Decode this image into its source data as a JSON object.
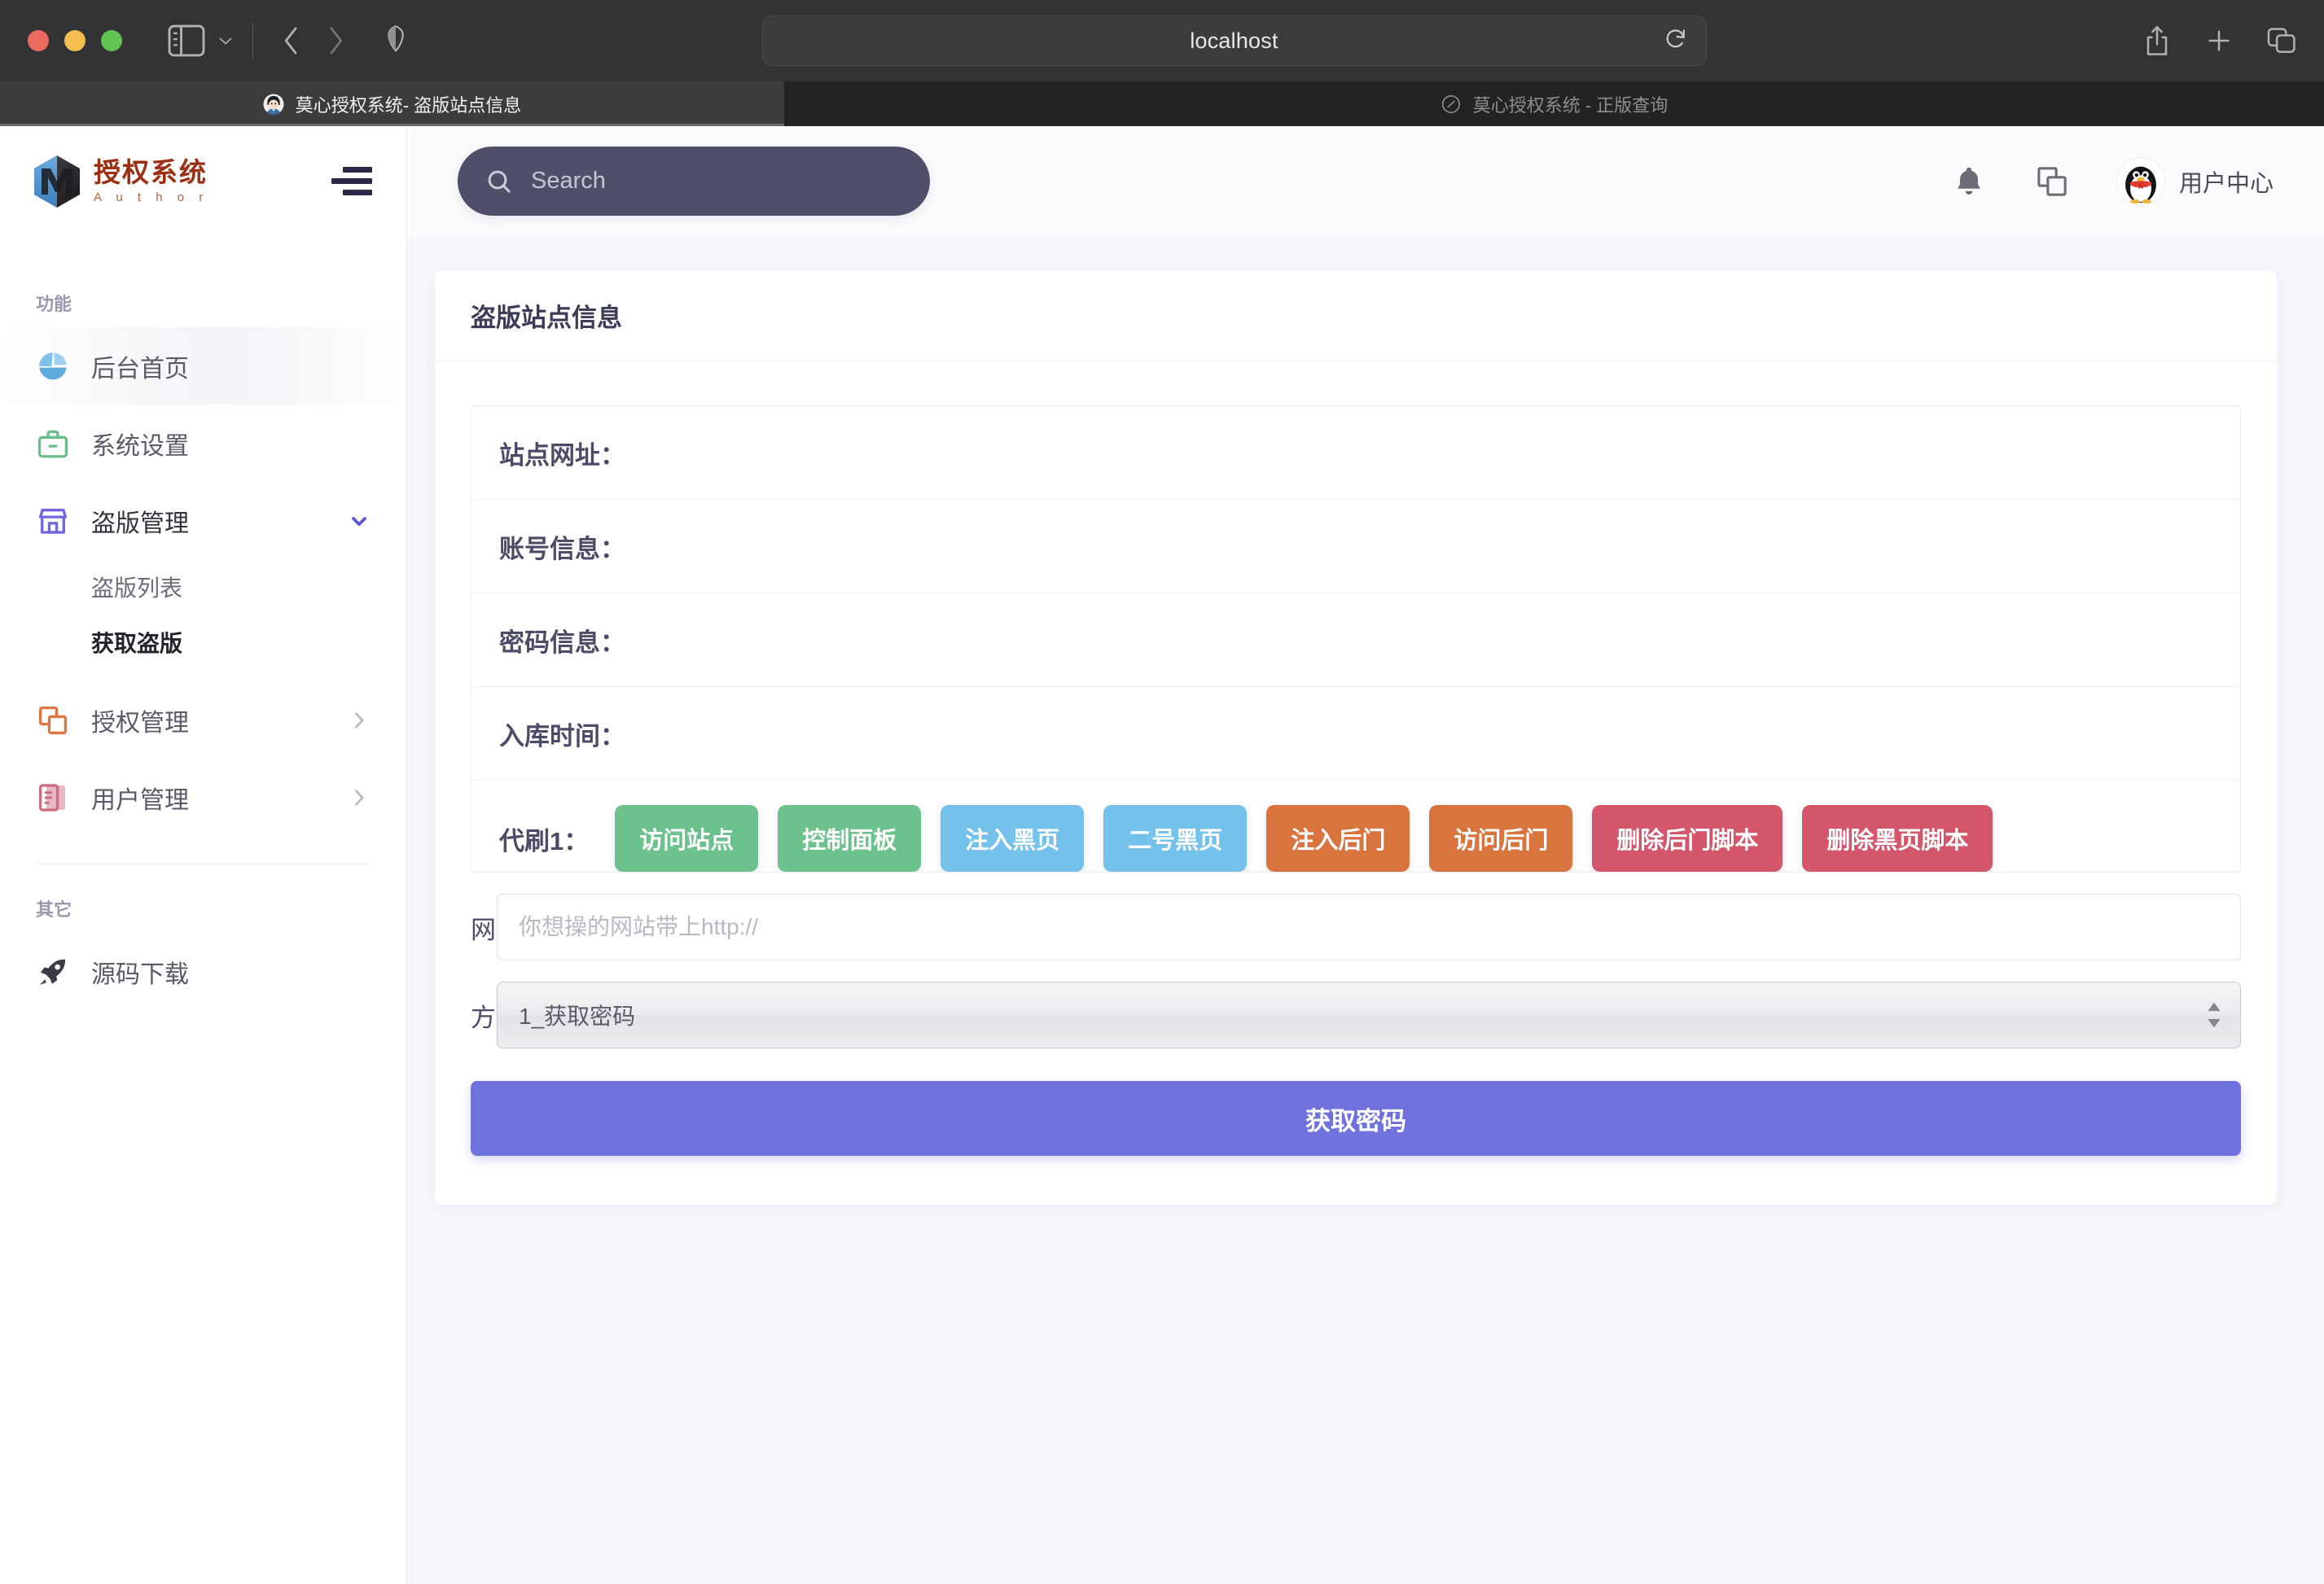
{
  "browser": {
    "url": "localhost",
    "traffic_lights": [
      "close",
      "minimize",
      "zoom"
    ],
    "tabs": [
      {
        "title": "莫心授权系统- 盗版站点信息",
        "active": true
      },
      {
        "title": "莫心授权系统 - 正版查询",
        "active": false
      }
    ],
    "toolbar_icons": [
      "sidebar-icon",
      "chevron-down-icon",
      "back-icon",
      "forward-icon",
      "shield-icon",
      "reload-icon",
      "share-icon",
      "new-tab-icon",
      "tab-overview-icon"
    ]
  },
  "sidebar": {
    "brand": {
      "title": "授权系统",
      "subtitle": "A u t h o r"
    },
    "menu_icon": "hamburger-icon",
    "groups": [
      {
        "label": "功能",
        "items": [
          {
            "label": "后台首页",
            "icon": "pie-chart-icon",
            "caret": null,
            "highlight": true
          },
          {
            "label": "系统设置",
            "icon": "toolbox-icon",
            "caret": null,
            "highlight": false
          },
          {
            "label": "盗版管理",
            "icon": "store-icon",
            "caret": "chevron-down-icon",
            "highlight": false,
            "children": [
              {
                "label": "盗版列表",
                "active": false
              },
              {
                "label": "获取盗版",
                "active": true
              }
            ]
          },
          {
            "label": "授权管理",
            "icon": "copy-icon",
            "caret": "chevron-right-icon",
            "highlight": false
          },
          {
            "label": "用户管理",
            "icon": "doc-icon",
            "caret": "chevron-right-icon",
            "highlight": false
          }
        ]
      },
      {
        "label": "其它",
        "items": [
          {
            "label": "源码下载",
            "icon": "rocket-icon",
            "caret": null,
            "highlight": false
          }
        ]
      }
    ]
  },
  "topbar": {
    "search": {
      "placeholder": "Search",
      "value": "",
      "icon": "search-icon"
    },
    "icons": [
      "bell-icon",
      "copy-icon"
    ],
    "user": {
      "name": "用户中心",
      "avatar": "penguin-avatar"
    }
  },
  "card": {
    "title": "盗版站点信息",
    "info_rows": [
      {
        "label": "站点网址：",
        "value": ""
      },
      {
        "label": "账号信息：",
        "value": ""
      },
      {
        "label": "密码信息：",
        "value": ""
      },
      {
        "label": "入库时间：",
        "value": ""
      }
    ],
    "action_label": "代刷1：",
    "actions": [
      {
        "label": "访问站点",
        "color": "#6cc28c"
      },
      {
        "label": "控制面板",
        "color": "#6cc28c"
      },
      {
        "label": "注入黑页",
        "color": "#74c2ec"
      },
      {
        "label": "二号黑页",
        "color": "#74c2ec"
      },
      {
        "label": "注入后门",
        "color": "#d9743f"
      },
      {
        "label": "访问后门",
        "color": "#d9743f"
      },
      {
        "label": "删除后门脚本",
        "color": "#d3566a"
      },
      {
        "label": "删除黑页脚本",
        "color": "#d3566a"
      }
    ],
    "form": {
      "url_label": "网址",
      "url_placeholder": "你想操的网站带上http://",
      "url_value": "",
      "mode_label": "方式",
      "mode_value": "1_获取密码",
      "mode_options": [
        "1_获取密码"
      ],
      "submit_label": "获取密码",
      "submit_color": "#6f72dd"
    }
  }
}
